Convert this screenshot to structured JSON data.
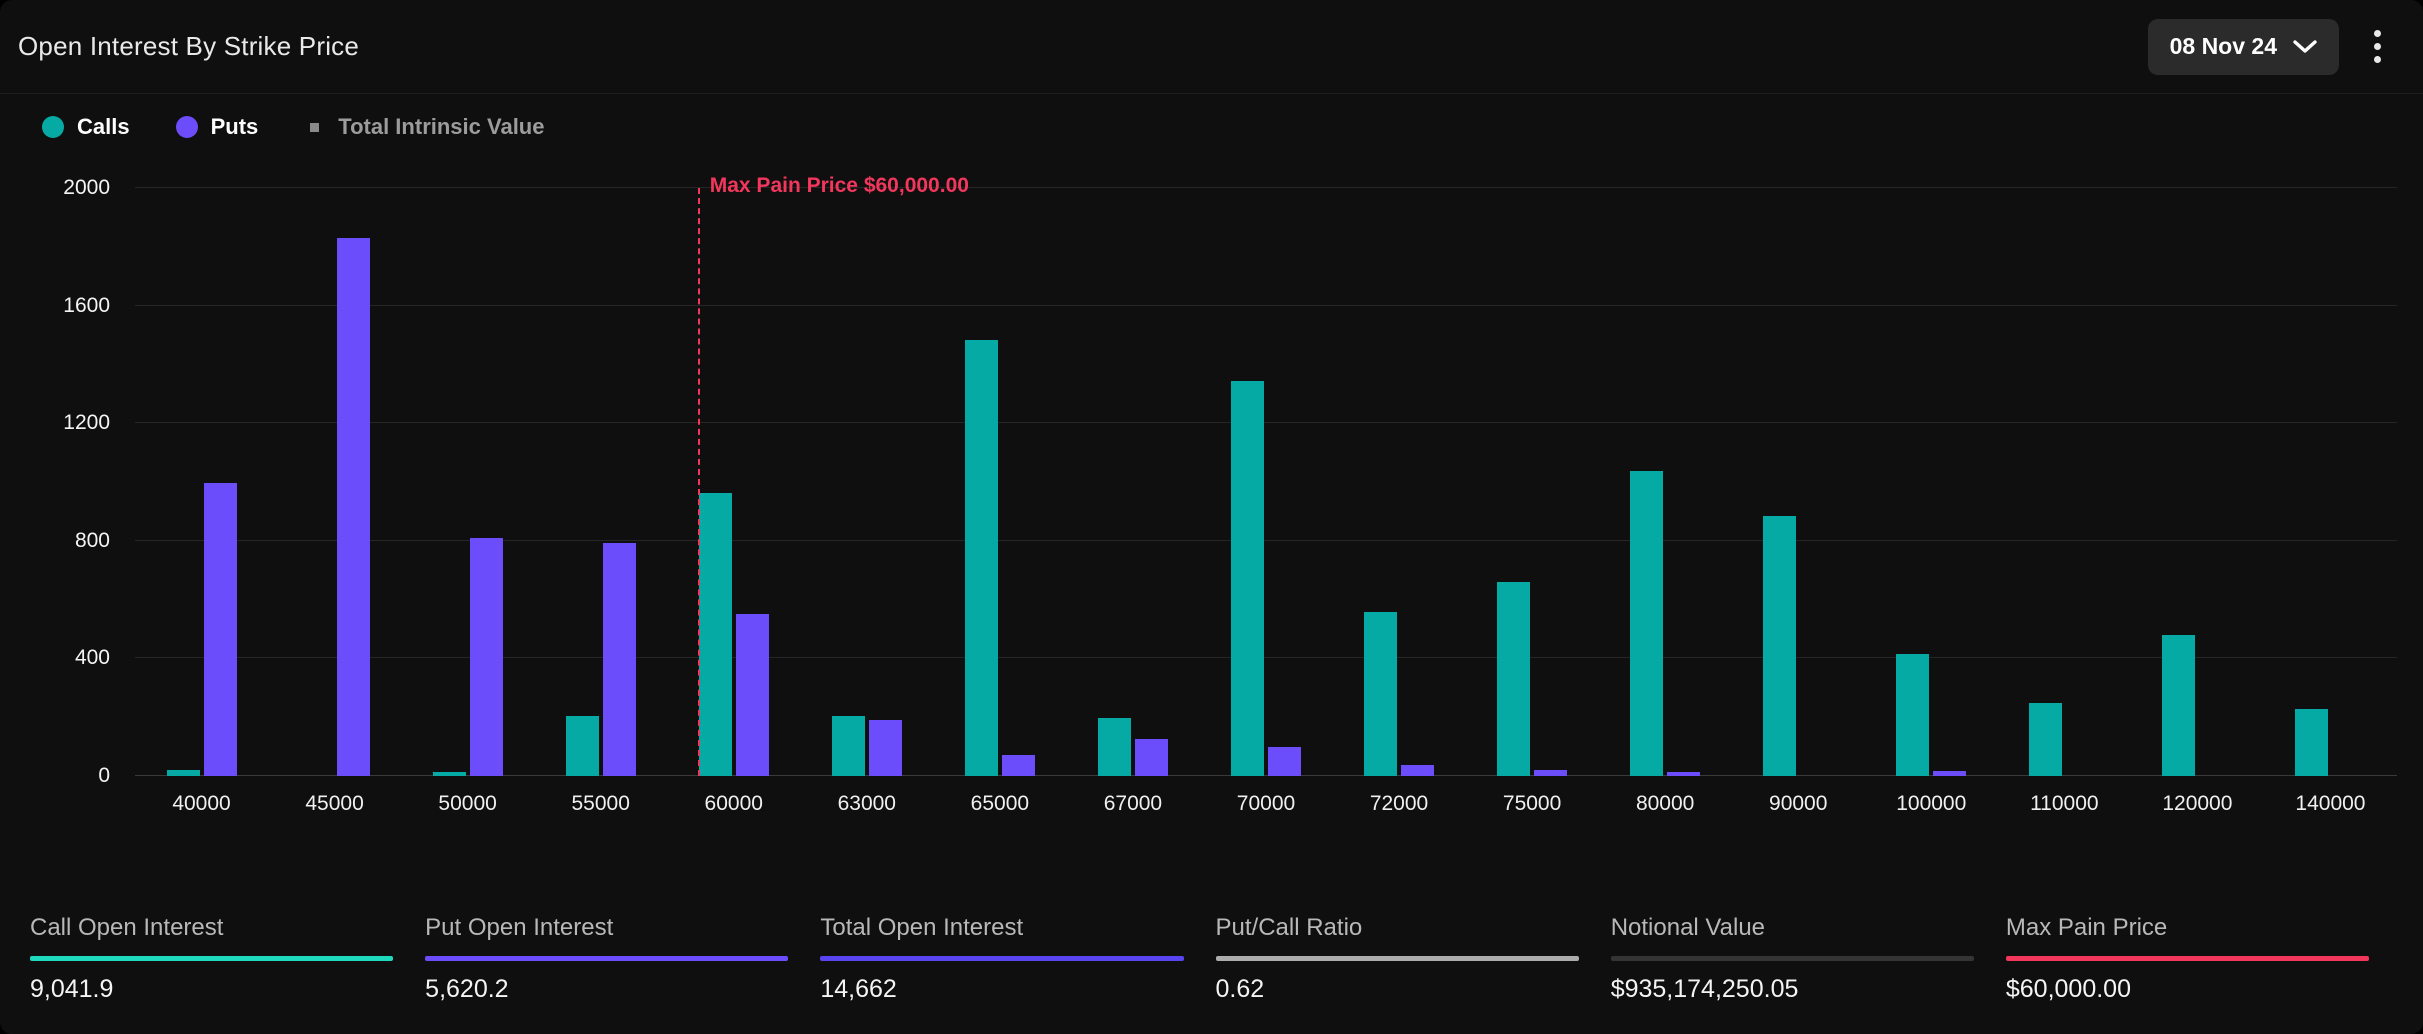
{
  "header": {
    "title": "Open Interest By Strike Price",
    "date_value": "08 Nov 24",
    "chevron_icon": "chevron-down-icon",
    "menu_icon": "more-vertical-icon"
  },
  "legend": [
    {
      "label": "Calls",
      "color": "#06AAA4",
      "marker": "circle",
      "active": true
    },
    {
      "label": "Puts",
      "color": "#6C4DFB",
      "marker": "circle",
      "active": true
    },
    {
      "label": "Total Intrinsic Value",
      "color": "#8A8A8A",
      "marker": "square",
      "active": false
    }
  ],
  "annotation": {
    "max_pain_label": "Max Pain Price $60,000.00",
    "max_pain_color": "#F2365C",
    "max_pain_category": "60000"
  },
  "chart_data": {
    "type": "bar",
    "title": "Open Interest By Strike Price",
    "xlabel": "",
    "ylabel": "",
    "ylim": [
      0,
      2000
    ],
    "yticks": [
      0,
      400,
      800,
      1200,
      1600,
      2000
    ],
    "grid": true,
    "legend_position": "top-left",
    "categories": [
      "40000",
      "45000",
      "50000",
      "55000",
      "60000",
      "63000",
      "65000",
      "67000",
      "70000",
      "72000",
      "75000",
      "80000",
      "90000",
      "100000",
      "110000",
      "120000",
      "140000"
    ],
    "series": [
      {
        "name": "Calls",
        "color": "#06AAA4",
        "values": [
          20,
          0,
          15,
          203,
          963,
          205,
          1484,
          196,
          1343,
          557,
          661,
          1038,
          884,
          415,
          247,
          478,
          228
        ]
      },
      {
        "name": "Puts",
        "color": "#6C4DFB",
        "values": [
          996,
          1830,
          810,
          792,
          552,
          190,
          70,
          125,
          97,
          36,
          22,
          12,
          0,
          16,
          0,
          0,
          0
        ]
      }
    ]
  },
  "stats": [
    {
      "label": "Call Open Interest",
      "value": "9,041.9",
      "color": "#1FD9BE"
    },
    {
      "label": "Put Open Interest",
      "value": "5,620.2",
      "color": "#6C4DFB"
    },
    {
      "label": "Total Open Interest",
      "value": "14,662",
      "color": "#5945F0"
    },
    {
      "label": "Put/Call Ratio",
      "value": "0.62",
      "color": "#ACACAC"
    },
    {
      "label": "Notional Value",
      "value": "$935,174,250.05",
      "color": "#343434"
    },
    {
      "label": "Max Pain Price",
      "value": "$60,000.00",
      "color": "#F2365C"
    }
  ]
}
